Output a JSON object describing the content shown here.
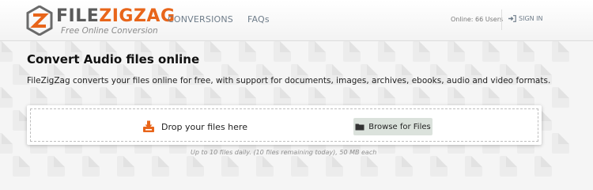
{
  "header": {
    "logo": {
      "wordmark_primary": "FILE",
      "wordmark_accent": "ZIGZAG",
      "tagline": "Free Online Conversion",
      "brand_color": "#e8651a"
    },
    "nav": [
      {
        "label": "CONVERSIONS"
      },
      {
        "label": "FAQs"
      }
    ],
    "online_status": "Online: 66 Users",
    "signin": {
      "label": "SIGN IN",
      "icon": "sign-in-icon"
    }
  },
  "main": {
    "title": "Convert Audio files online",
    "description": "FileZigZag converts your files online for free, with support for documents, images, archives, ebooks, audio and video formats.",
    "dropzone": {
      "drop_label": "Drop your files here",
      "drop_icon": "download-tray-icon",
      "browse_label": "Browse for Files",
      "browse_icon": "folder-icon"
    },
    "limits_note": "Up to 10 files daily. (10 files remaining today), 50 MB each"
  }
}
